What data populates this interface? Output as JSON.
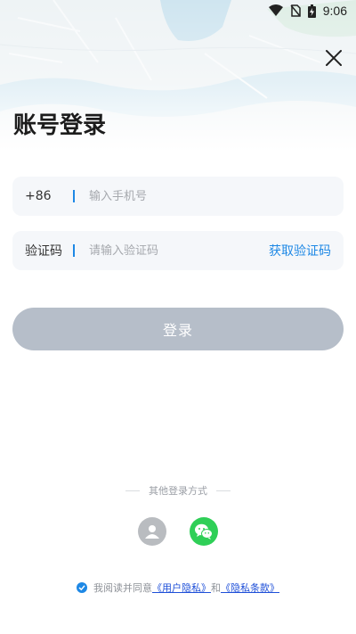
{
  "status_bar": {
    "time": "9:06",
    "icons": [
      "wifi-icon",
      "no-sim-icon",
      "battery-icon"
    ]
  },
  "page": {
    "title": "账号登录",
    "close_icon": "close-icon"
  },
  "phone_field": {
    "prefix": "+86",
    "placeholder": "输入手机号",
    "value": ""
  },
  "code_field": {
    "label": "验证码",
    "placeholder": "请输入验证码",
    "value": "",
    "get_code_label": "获取验证码"
  },
  "login_button": {
    "label": "登录"
  },
  "other_login": {
    "title": "其他登录方式",
    "methods": [
      {
        "icon": "user-icon"
      },
      {
        "icon": "wechat-icon"
      }
    ]
  },
  "agreement": {
    "checked": true,
    "prefix": "我阅读并同意",
    "user_privacy": "《用户隐私》",
    "and": "和",
    "privacy_terms": "《隐私条款》"
  },
  "colors": {
    "accent": "#1e88e5",
    "button_disabled": "#b6bec9",
    "wechat_green": "#2fcf57",
    "field_bg": "#f5f7fa"
  }
}
